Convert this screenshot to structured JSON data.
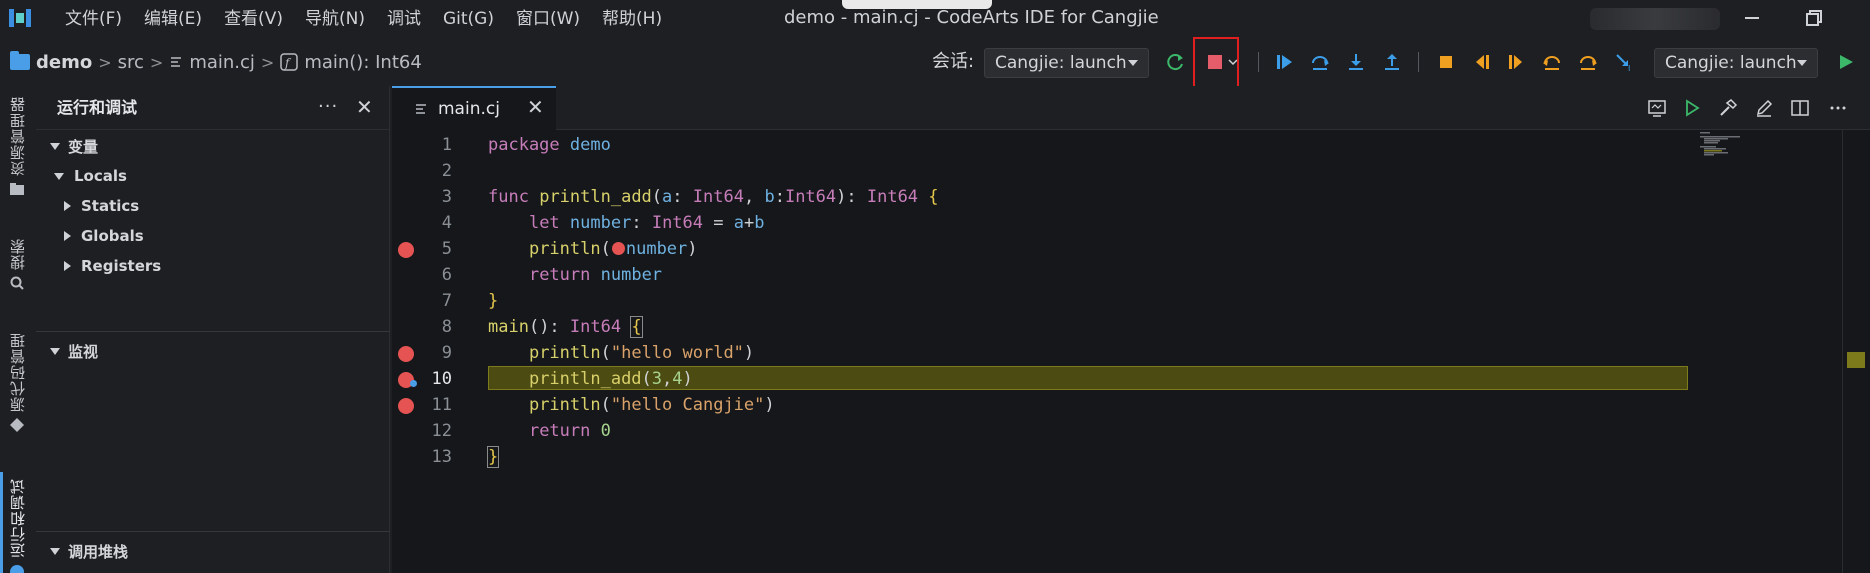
{
  "menu": [
    "文件(F)",
    "编辑(E)",
    "查看(V)",
    "导航(N)",
    "调试",
    "Git(G)",
    "窗口(W)",
    "帮助(H)"
  ],
  "window_title": "demo - main.cj - CodeArts IDE for Cangjie",
  "breadcrumb": {
    "project": "demo",
    "src": "src",
    "file": "main.cj",
    "symbol": "main(): Int64",
    "sep": ">"
  },
  "toolbar": {
    "session_label": "会话:",
    "session_select": "Cangjie: launch",
    "run_config_select": "Cangjie: launch"
  },
  "activity_bar": {
    "explorer": "资源管理器",
    "search": "搜索",
    "scm": "源代码管理",
    "run_debug": "运行和调试"
  },
  "sidebar": {
    "title": "运行和调试",
    "more": "···",
    "close": "✕",
    "variables_header": "变量",
    "variables": [
      "Locals",
      "Statics",
      "Globals",
      "Registers"
    ],
    "watch_header": "监视",
    "callstack_header": "调用堆栈"
  },
  "editor": {
    "tab_label": "main.cj",
    "tab_close": "✕",
    "line_numbers": [
      "1",
      "2",
      "3",
      "4",
      "5",
      "6",
      "7",
      "8",
      "9",
      "10",
      "11",
      "12",
      "13"
    ],
    "current_line": 10
  },
  "colors": {
    "accent": "#4a9ee8",
    "breakpoint": "#e55353",
    "highlight_line": "#4c4b12",
    "annotation": "#e02020"
  }
}
